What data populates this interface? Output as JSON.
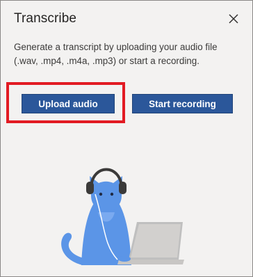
{
  "panel": {
    "title": "Transcribe",
    "close_icon": "close-icon",
    "description": "Generate a transcript by uploading your audio file (.wav, .mp4, .m4a, .mp3) or start a recording."
  },
  "actions": {
    "upload_label": "Upload audio",
    "record_label": "Start recording"
  },
  "colors": {
    "button": "#2b579a",
    "highlight": "#e21b23",
    "cat": "#5b95e7"
  },
  "illustration": "cat-with-headphones-and-laptop"
}
